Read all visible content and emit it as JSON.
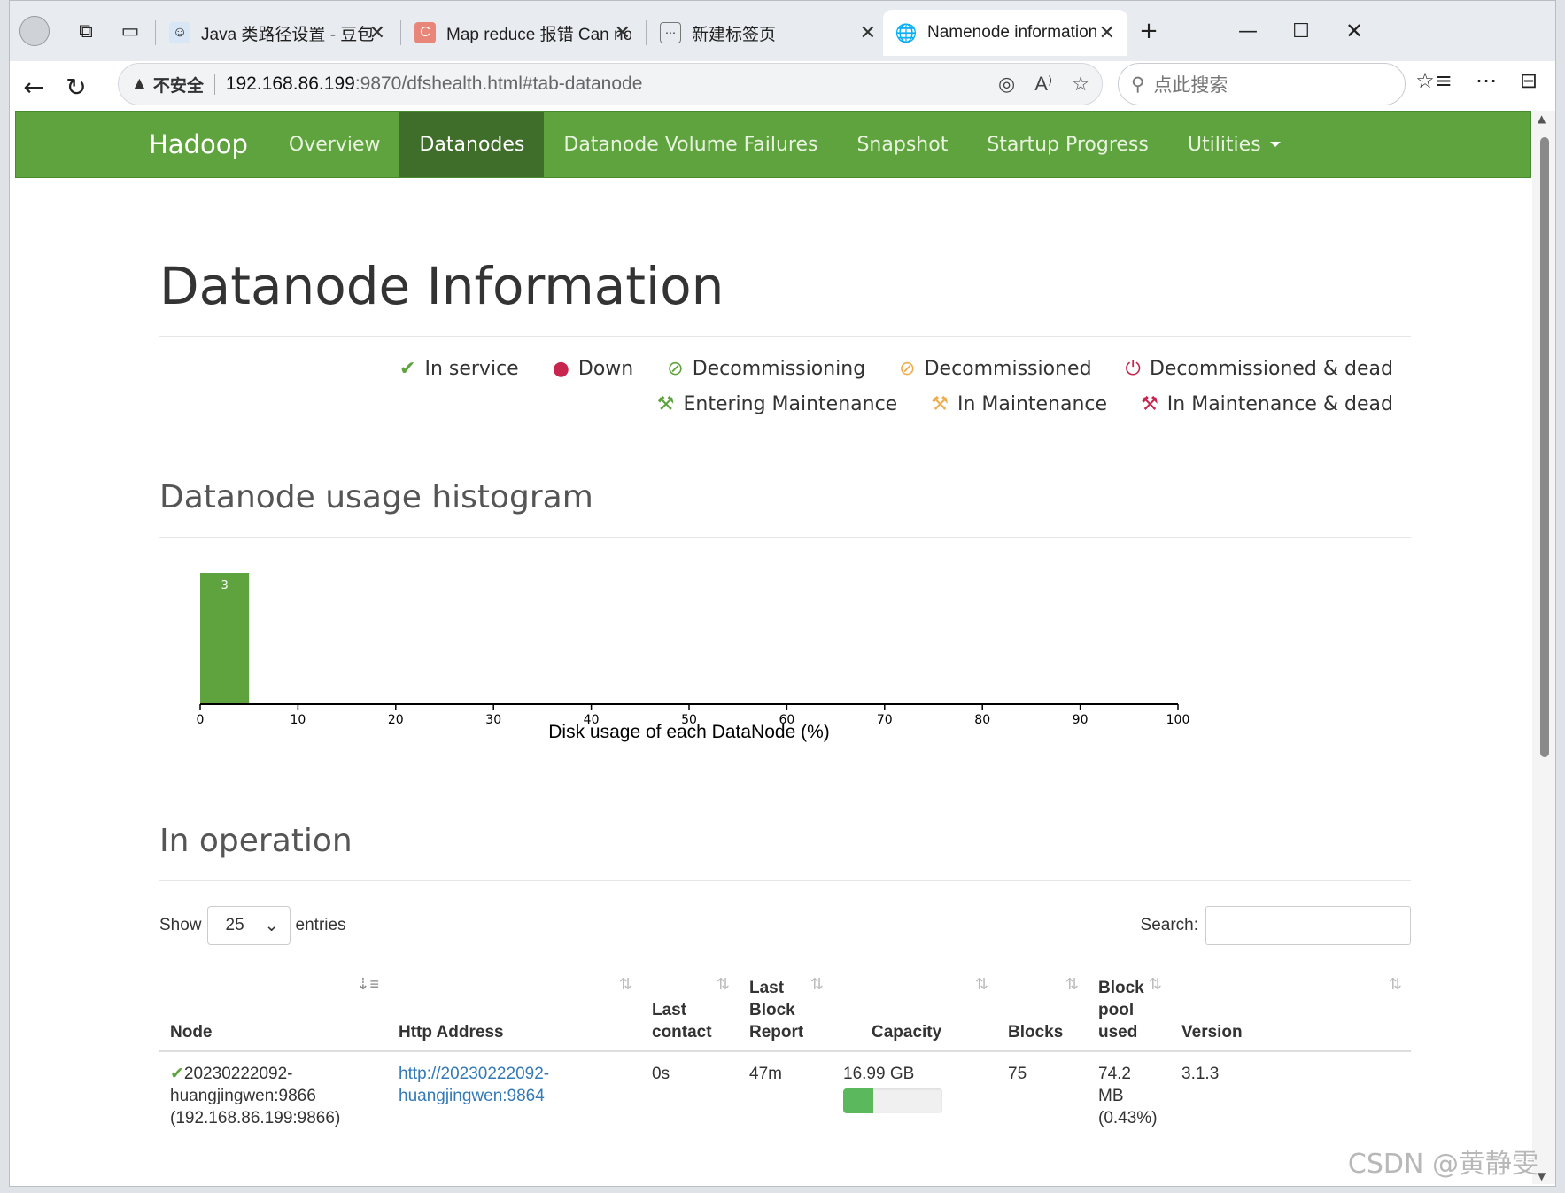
{
  "browser": {
    "tabs": [
      {
        "title": "Java 类路径设置 - 豆包",
        "active": false
      },
      {
        "title": "Map reduce 报错 Can not c",
        "active": false
      },
      {
        "title": "新建标签页",
        "active": false
      },
      {
        "title": "Namenode information",
        "active": true
      }
    ],
    "new_tab": "+",
    "addr": {
      "warning": "不安全",
      "host": "192.168.86.199",
      "rest": ":9870/dfshealth.html#tab-datanode"
    },
    "search_placeholder": "点此搜索"
  },
  "navbar": {
    "brand": "Hadoop",
    "items": [
      "Overview",
      "Datanodes",
      "Datanode Volume Failures",
      "Snapshot",
      "Startup Progress",
      "Utilities"
    ],
    "active": "Datanodes"
  },
  "page_title": "Datanode Information",
  "legend": [
    {
      "label": "In service",
      "icon": "check-icon",
      "glyph": "✔",
      "color": "#5fa33e"
    },
    {
      "label": "Down",
      "icon": "exclamation-icon",
      "glyph": "❗",
      "color": "#c7254e"
    },
    {
      "label": "Decommissioning",
      "icon": "ban-icon",
      "glyph": "⊘",
      "color": "#5fa33e"
    },
    {
      "label": "Decommissioned",
      "icon": "ban-icon",
      "glyph": "⊘",
      "color": "#f0ad4e"
    },
    {
      "label": "Decommissioned & dead",
      "icon": "power-icon",
      "glyph": "⏻",
      "color": "#c7254e"
    },
    {
      "label": "Entering Maintenance",
      "icon": "wrench-icon",
      "glyph": "🔧",
      "color": "#5fa33e"
    },
    {
      "label": "In Maintenance",
      "icon": "wrench-icon",
      "glyph": "🔧",
      "color": "#f0ad4e"
    },
    {
      "label": "In Maintenance & dead",
      "icon": "wrench-icon",
      "glyph": "🔧",
      "color": "#c7254e"
    }
  ],
  "histogram_heading": "Datanode usage histogram",
  "chart_data": {
    "type": "bar",
    "xlabel": "Disk usage of each DataNode (%)",
    "xlim": [
      0,
      100
    ],
    "x_ticks": [
      0,
      10,
      20,
      30,
      40,
      50,
      60,
      70,
      80,
      90,
      100
    ],
    "bins": [
      {
        "x0": 0,
        "x1": 5,
        "count": 3
      }
    ],
    "bar_color": "#5fa33e"
  },
  "operation_heading": "In operation",
  "table_controls": {
    "show_label": "Show",
    "entries_value": "25",
    "entries_label": "entries",
    "search_label": "Search:"
  },
  "table": {
    "columns": [
      {
        "label": "Node",
        "sort": "⇣≡"
      },
      {
        "label": "Http Address",
        "sort": "⇅"
      },
      {
        "label": "Last contact",
        "sort": "⇅"
      },
      {
        "label": "Last Block Report",
        "sort": "⇅"
      },
      {
        "label": "Capacity",
        "sort": "⇅"
      },
      {
        "label": "Blocks",
        "sort": "⇅"
      },
      {
        "label": "Block pool used",
        "sort": "⇅"
      },
      {
        "label": "Version",
        "sort": "⇅"
      }
    ],
    "rows": [
      {
        "node_line1": "20230222092-",
        "node_line2": "huangjingwen:9866",
        "node_line3": "(192.168.86.199:9866)",
        "http_line1": "http://20230222092-",
        "http_line2": "huangjingwen:9864",
        "last_contact": "0s",
        "last_block_report": "47m",
        "capacity": "16.99 GB",
        "capacity_used_fraction": 0.3,
        "blocks": "75",
        "bp_used_line1": "74.2 MB",
        "bp_used_line2": "(0.43%)",
        "version": "3.1.3"
      }
    ]
  },
  "watermark": "CSDN @黄静雯"
}
